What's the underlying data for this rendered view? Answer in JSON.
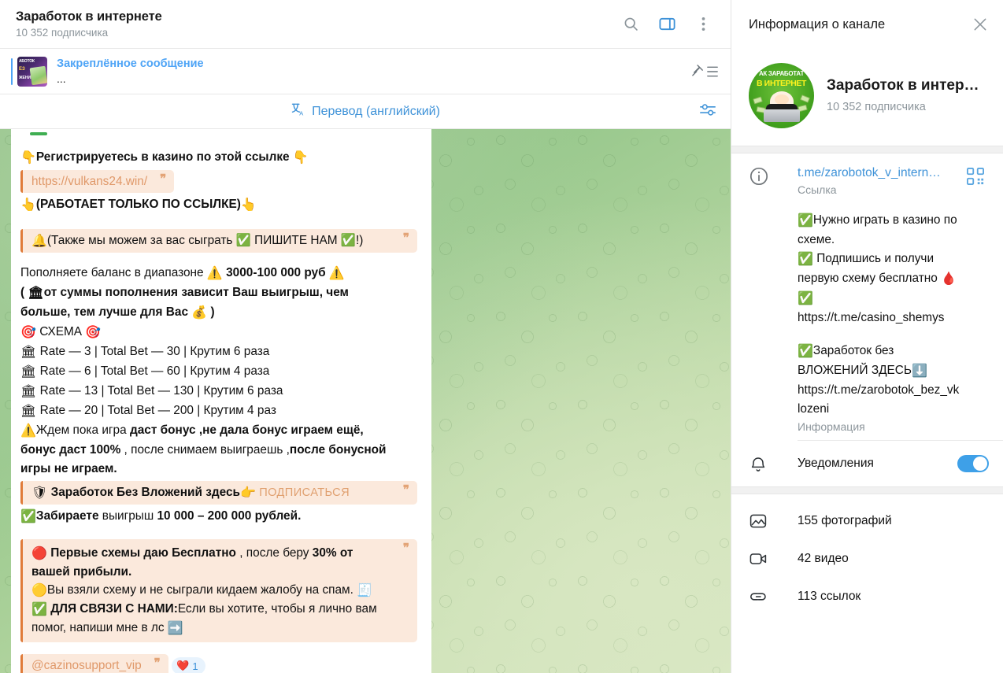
{
  "header": {
    "title": "Заработок в интернете",
    "subscribers": "10 352 подписчика",
    "icons": {
      "search": "search-icon",
      "panel": "side-panel-icon",
      "more": "more-vertical-icon"
    }
  },
  "pinned": {
    "label": "Закреплённое сообщение",
    "preview": "...",
    "thumb_text_1": "АБОТОК",
    "thumb_text_2": "ЕЗ",
    "thumb_text_3": "ЖЕНИЙ"
  },
  "translate": {
    "label": "Перевод (английский)",
    "icon": "translate-icon",
    "settings_icon": "sliders-icon"
  },
  "messages": {
    "line_register": "Регистрируетесь в казино по этой ссылке",
    "quote_link": "https://vulkans24.win/",
    "line_works_only": "(РАБОТАЕТ ТОЛЬКО ПО ССЫЛКЕ)",
    "quote_play_for_you": "(Также мы можем за вас сыграть ✅ ПИШИТЕ НАМ ✅!)",
    "balance_l1_a": "Пополняете баланс  в диапазоне ",
    "balance_l1_b": "3000-100 000 руб",
    "balance_l2": "от суммы пополнения зависит Ваш выигрыш, чем",
    "balance_l3": "больше, тем лучше для Вас",
    "scheme_title": "СХЕМА",
    "scheme_rows": [
      "Rate — 3 | Total Bet — 30 | Крутим 6 раза",
      "Rate  — 6 | Total Bet  — 60 | Крутим 4 раза",
      "Rate  — 13 | Total Bet  — 130 | Крутим 6 раза",
      "Rate  — 20 | Total Bet  — 200 | Крутим 4 раз"
    ],
    "wait_l1_a": "Ждем пока игра ",
    "wait_l1_b": "даст бонус ,не дала бонус играем ещё,",
    "wait_l2_a": "бонус даст 100%",
    "wait_l2_b": " , после снимаем выиграешь ,",
    "wait_l2_c": "после бонусной",
    "wait_l3": "игры не играем.",
    "quote_zarabotok_text": "Заработок Без Вложений здесь",
    "quote_zarabotok_btn": "ПОДПИСАТЬСЯ",
    "take_a": "Забираете",
    "take_b": " выигрыш ",
    "take_c": "10 000 – 200 000 рублей.",
    "bubble2_l1_a": "Первые схемы даю Бесплатно",
    "bubble2_l1_b": " , после  беру ",
    "bubble2_l1_c": "30% от",
    "bubble2_l2": "вашей прибыли.",
    "bubble2_l3": "Вы взяли схему и не сыграли кидаем жалобу на спам.",
    "bubble2_l4_a": "ДЛЯ СВЯЗИ С НАМИ:",
    "bubble2_l4_b": "Если вы хотите, чтобы я лично вам",
    "bubble2_l5": "помог, напиши мне в лс",
    "quote_support": "@cazinosupport_vip",
    "reaction_emoji": "❤️",
    "reaction_count": "1"
  },
  "info_panel": {
    "title": "Информация о канале",
    "close_icon": "close-icon",
    "channel_name": "Заработок в интер…",
    "channel_subscribers": "10 352 подписчика",
    "avatar_cap_1": "АК ЗАРАБОТАТ",
    "avatar_cap_2": "В ИНТЕРНЕТ",
    "link_row": {
      "icon": "info-circle-icon",
      "value": "t.me/zarobotok_v_intern…",
      "caption": "Ссылка",
      "qr_icon": "qr-code-icon"
    },
    "description": {
      "l1": "Нужно играть в казино по",
      "l2": "схеме.",
      "l3": "Подпишись и получи",
      "l4": "первую схему бесплатно",
      "l5_link": "https://t.me/casino_shemys",
      "l6": "Заработок без",
      "l7": "ВЛОЖЕНИЙ ЗДЕСЬ",
      "l8_link_a": "https://t.me/zarobotok_bez_vk",
      "l8_link_b": "lozeni",
      "caption": "Информация"
    },
    "notifications": {
      "icon": "bell-icon",
      "label": "Уведомления",
      "enabled": true
    },
    "media": [
      {
        "icon": "photo-icon",
        "label": "155 фотографий"
      },
      {
        "icon": "video-icon",
        "label": "42 видео"
      },
      {
        "icon": "link-icon",
        "label": "113 ссылок"
      }
    ]
  },
  "colors": {
    "accent": "#3e92d8",
    "quote_bg": "#fbe9dc",
    "quote_bar": "#e07b39",
    "toggle_on": "#3ea0e8",
    "wallpaper": "#9ac98e"
  }
}
